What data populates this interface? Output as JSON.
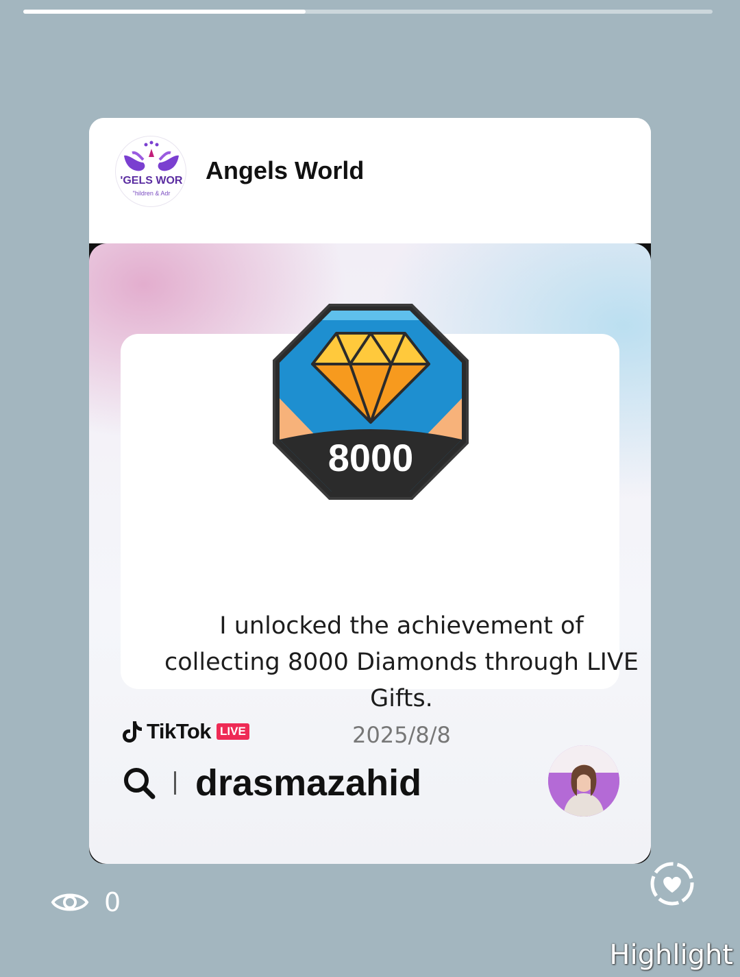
{
  "story": {
    "progress": 0.41
  },
  "post": {
    "page_name": "Angels World",
    "logo": {
      "text": "'GELS WOR",
      "subtext": "\"hildren & Adr"
    }
  },
  "achievement": {
    "badge_value": "8000",
    "text": "I unlocked the achievement of collecting 8000 Diamonds through LIVE Gifts.",
    "date": "2025/8/8",
    "brand": "TikTok",
    "live_label": "LIVE",
    "username": "drasmazahid"
  },
  "footer": {
    "view_count": "0",
    "highlight_label": "Highlight"
  },
  "icons": [
    "eye-icon",
    "highlight-heart-icon",
    "search-icon",
    "tiktok-note-icon",
    "diamond-icon"
  ],
  "colors": {
    "background": "#a3b6bf",
    "badge_blue": "#1e8fd0",
    "badge_gold": "#f7b733",
    "live_red": "#ee2a55"
  }
}
